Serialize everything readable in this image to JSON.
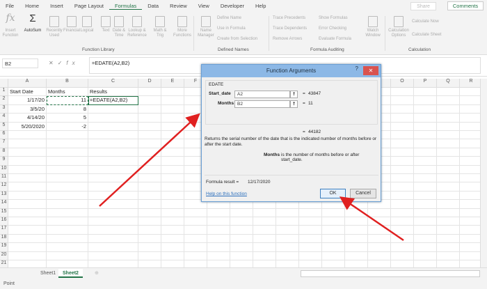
{
  "ribbon_tabs": [
    "File",
    "Home",
    "Insert",
    "Page Layout",
    "Formulas",
    "Data",
    "Review",
    "View",
    "Developer",
    "Help"
  ],
  "active_tab": "Formulas",
  "share_label": "Share",
  "comments_label": "Comments",
  "ribbon": {
    "function_library": {
      "label": "Function Library",
      "buttons": [
        "Insert Function",
        "AutoSum",
        "Recently Used",
        "Financial",
        "Logical",
        "Text",
        "Date & Time",
        "Lookup & Reference",
        "Math & Trig",
        "More Functions"
      ]
    },
    "defined_names": {
      "label": "Defined Names",
      "name_manager": "Name Manager",
      "items": [
        "Define Name",
        "Use in Formula",
        "Create from Selection"
      ]
    },
    "formula_auditing": {
      "label": "Formula Auditing",
      "items": [
        "Trace Precedents",
        "Trace Dependents",
        "Remove Arrows",
        "Show Formulas",
        "Error Checking",
        "Evaluate Formula"
      ],
      "watch": "Watch Window"
    },
    "calculation": {
      "label": "Calculation",
      "options": "Calculation Options",
      "items": [
        "Calculate Now",
        "Calculate Sheet"
      ]
    }
  },
  "formula_bar": {
    "name_box": "B2",
    "formula": "=EDATE(A2,B2)"
  },
  "columns": [
    "A",
    "B",
    "C",
    "D",
    "E",
    "F",
    "G",
    "H",
    "I",
    "J",
    "K",
    "L",
    "M",
    "N",
    "O",
    "P",
    "Q",
    "R"
  ],
  "rows": [
    [
      "Start Date",
      "Months",
      "Results"
    ],
    [
      "1/17/20",
      "11",
      "=EDATE(A2,B2)"
    ],
    [
      "3/5/20",
      "8",
      ""
    ],
    [
      "4/14/20",
      "5",
      ""
    ],
    [
      "5/20/2020",
      "-2",
      ""
    ]
  ],
  "row_count": 22,
  "dialog": {
    "title": "Function Arguments",
    "help_glyph": "?",
    "close_glyph": "✕",
    "function_name": "EDATE",
    "args": [
      {
        "label": "Start_date",
        "value": "A2",
        "result": "43847"
      },
      {
        "label": "Months",
        "value": "B2",
        "result": "11"
      }
    ],
    "eq": "=",
    "total": "44182",
    "description": "Returns the serial number of the date that is the indicated number of months before or after the start date.",
    "arg_help_name": "Months",
    "arg_help_text": "is the number of months before or after start_date.",
    "formula_result_label": "Formula result =",
    "formula_result": "12/17/2020",
    "help_link": "Help on this function",
    "ok": "OK",
    "cancel": "Cancel"
  },
  "sheets": [
    "Sheet1",
    "Sheet2"
  ],
  "active_sheet": "Sheet2",
  "status": "Point",
  "annotation_color": "#e02020"
}
